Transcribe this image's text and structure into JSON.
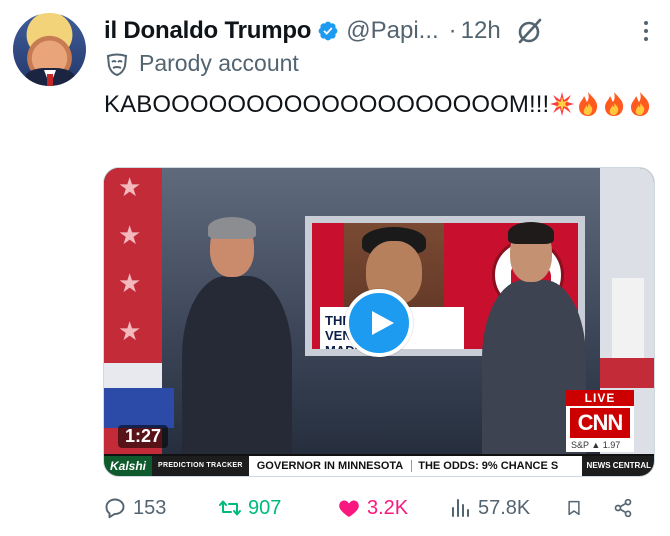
{
  "post": {
    "display_name": "il Donaldo Trumpo",
    "handle": "@Papi...",
    "separator": "·",
    "time": "12h",
    "label": "Parody account",
    "text": "KABOOOOOOOOOOOOOOOOOOOM!!!",
    "text_emojis": [
      "collision-emoji",
      "fire-emoji",
      "fire-emoji",
      "fire-emoji"
    ]
  },
  "media": {
    "type": "video",
    "duration": "1:27",
    "screen_caption": "THE GOP & VENEZUELA MADURO",
    "live_label": "LIVE",
    "network": "CNN",
    "index_label": "S&P ▲ 1.97",
    "ticker": {
      "brand": "Kalshi",
      "segment": "PREDICTION TRACKER",
      "headline_a": "GOVERNOR IN MINNESOTA",
      "headline_b": "THE ODDS: 9% CHANCE S",
      "tag": "NEWS CENTRAL"
    }
  },
  "actions": {
    "replies": "153",
    "reposts": "907",
    "likes": "3.2K",
    "views": "57.8K"
  },
  "colors": {
    "verified_badge": "#1d9bf0",
    "play_button": "#1d9bf0",
    "repost_active": "#00ba7c",
    "like_active": "#f91880",
    "muted_text": "#536471"
  }
}
